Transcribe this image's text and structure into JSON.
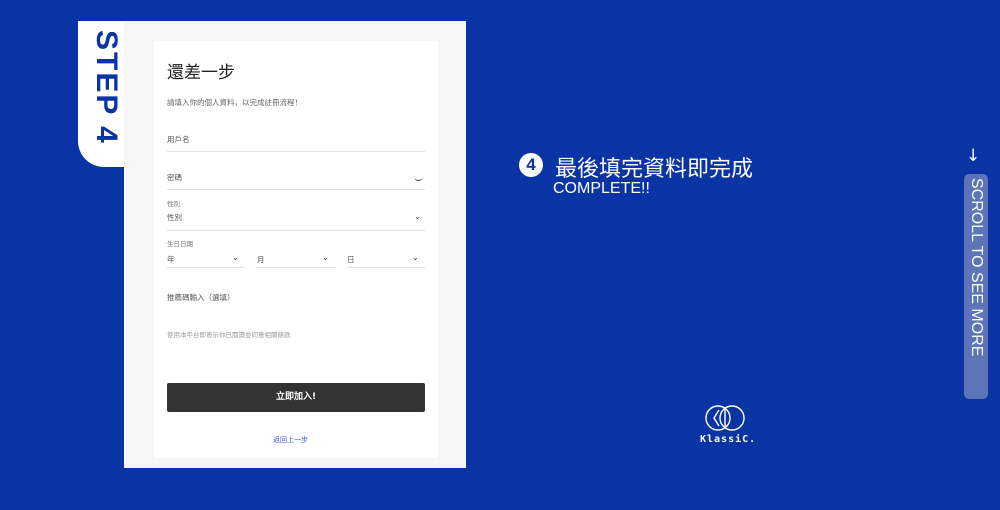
{
  "step_tab": {
    "label": "STEP 4"
  },
  "form": {
    "title": "還差一步",
    "subtitle": "請填入你的個人資料，以完成註冊流程！",
    "username_placeholder": "用戶名",
    "password_placeholder": "密碼",
    "gender": {
      "label": "性別",
      "value": "性別"
    },
    "birthday": {
      "label": "生日日期",
      "year": "年",
      "month": "月",
      "day": "日"
    },
    "referral_label": "推薦碼輸入（選填）",
    "agreement": "使用本平台即表示你已閱讀並同意相關條款",
    "join_button": "立即加入!",
    "back_link": "返回上一步"
  },
  "step_info": {
    "number": "4",
    "heading": "最後填完資料即完成",
    "subheading": "COMPLETE!!"
  },
  "brand": {
    "name": "KlassiC."
  },
  "scroll_hint": {
    "text": "SCROLL TO SEE MORE",
    "arrow": "↓"
  },
  "colors": {
    "background": "#0a33a3",
    "button": "#333333",
    "link": "#3a5bd1"
  },
  "icons": [
    "eye-icon",
    "chevron-down-icon",
    "arrow-down-icon",
    "logo-mark"
  ]
}
